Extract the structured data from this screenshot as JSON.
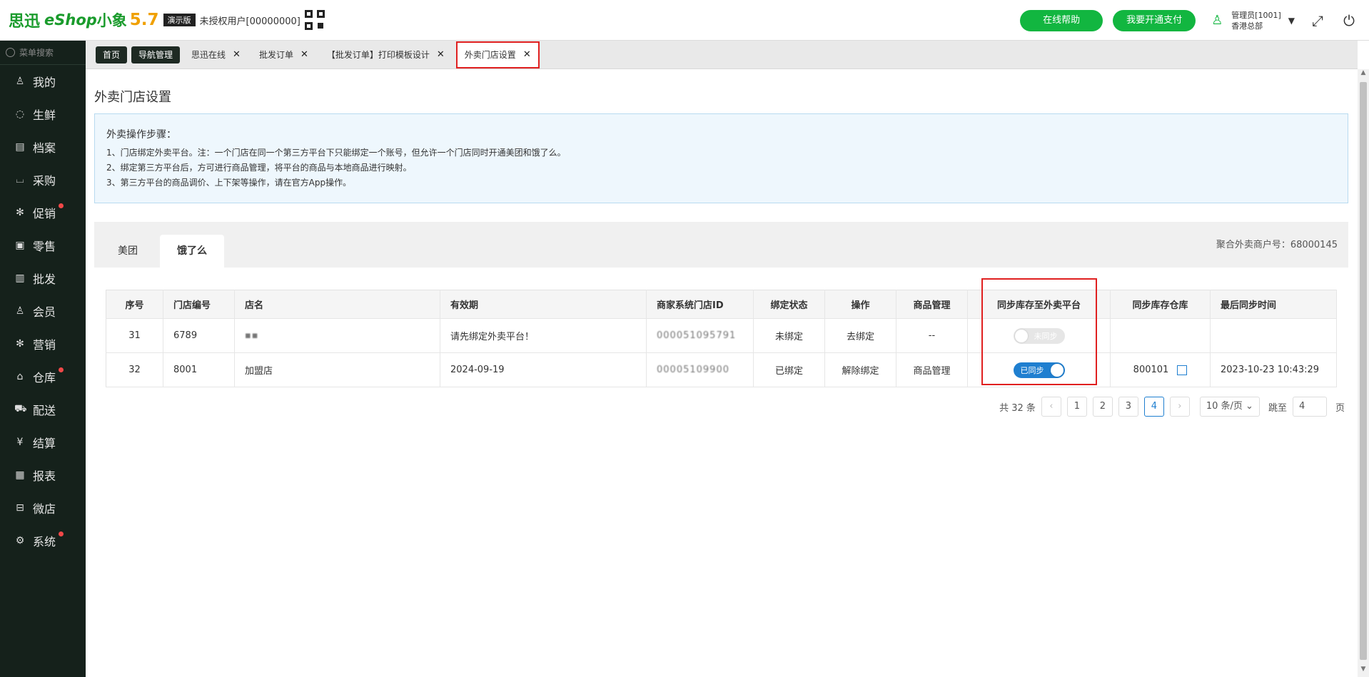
{
  "header": {
    "logo_cn": "思迅",
    "logo_eshop": "eShop",
    "logo_xx": "小象",
    "logo_ver": "5.7",
    "demo_badge": "演示版",
    "unauth_user": "未授权用户[00000000]",
    "help_button": "在线帮助",
    "pay_button": "我要开通支付",
    "admin_name": "管理员[1001]",
    "admin_store": "香港总部"
  },
  "sidebar": {
    "search_placeholder": "菜单搜索",
    "items": [
      {
        "label": "我的",
        "icon": "user-icon"
      },
      {
        "label": "生鲜",
        "icon": "apple-icon"
      },
      {
        "label": "档案",
        "icon": "archive-icon"
      },
      {
        "label": "采购",
        "icon": "basket-icon"
      },
      {
        "label": "促销",
        "icon": "promotion-icon"
      },
      {
        "label": "零售",
        "icon": "bag-icon"
      },
      {
        "label": "批发",
        "icon": "wholesale-icon"
      },
      {
        "label": "会员",
        "icon": "member-icon"
      },
      {
        "label": "营销",
        "icon": "marketing-icon"
      },
      {
        "label": "仓库",
        "icon": "warehouse-icon"
      },
      {
        "label": "配送",
        "icon": "truck-icon"
      },
      {
        "label": "结算",
        "icon": "yen-icon"
      },
      {
        "label": "报表",
        "icon": "report-icon"
      },
      {
        "label": "微店",
        "icon": "shop-icon"
      },
      {
        "label": "系统",
        "icon": "settings-icon"
      }
    ]
  },
  "tabs": {
    "home": "首页",
    "nav": "导航管理",
    "t1": "思迅在线",
    "t2": "批发订单",
    "t3": "【批发订单】打印模板设计",
    "t4": "外卖门店设置",
    "close": "✕"
  },
  "page": {
    "title": "外卖门店设置",
    "info_heading": "外卖操作步骤：",
    "info_lines": [
      "1、门店绑定外卖平台。注：一个门店在同一个第三方平台下只能绑定一个账号，但允许一个门店同时开通美团和饿了么。",
      "2、绑定第三方平台后，方可进行商品管理，将平台的商品与本地商品进行映射。",
      "3、第三方平台的商品调价、上下架等操作，请在官方App操作。"
    ],
    "platform_tabs": {
      "meituan": "美团",
      "eleme": "饿了么"
    },
    "merchant_no": "聚合外卖商户号：68000145"
  },
  "table": {
    "headers": [
      "序号",
      "门店编号",
      "店名",
      "有效期",
      "商家系统门店ID",
      "绑定状态",
      "操作",
      "商品管理",
      "同步库存至外卖平台",
      "同步库存仓库",
      "最后同步时间"
    ],
    "rows": [
      {
        "seq": "31",
        "store_no": "6789",
        "name": "",
        "validity": "请先绑定外卖平台！",
        "system_id": "000051095791",
        "status": "未绑定",
        "action": "去绑定",
        "goods": "--",
        "sync_label": "未同步",
        "warehouse": "",
        "last_sync": ""
      },
      {
        "seq": "32",
        "store_no": "8001",
        "name": "加盟店",
        "validity": "2024-09-19",
        "system_id": "00005109900",
        "status": "已绑定",
        "action": "解除绑定",
        "goods": "商品管理",
        "sync_label": "已同步",
        "warehouse": "800101",
        "last_sync": "2023-10-23 10:43:29"
      }
    ]
  },
  "pager": {
    "total": "共 32 条",
    "prev": "‹",
    "next": "›",
    "pages": [
      "1",
      "2",
      "3",
      "4"
    ],
    "current": "4",
    "size": "10 条/页 ⌄",
    "goto_label": "跳至",
    "goto_value": "4",
    "page_unit": "页"
  }
}
